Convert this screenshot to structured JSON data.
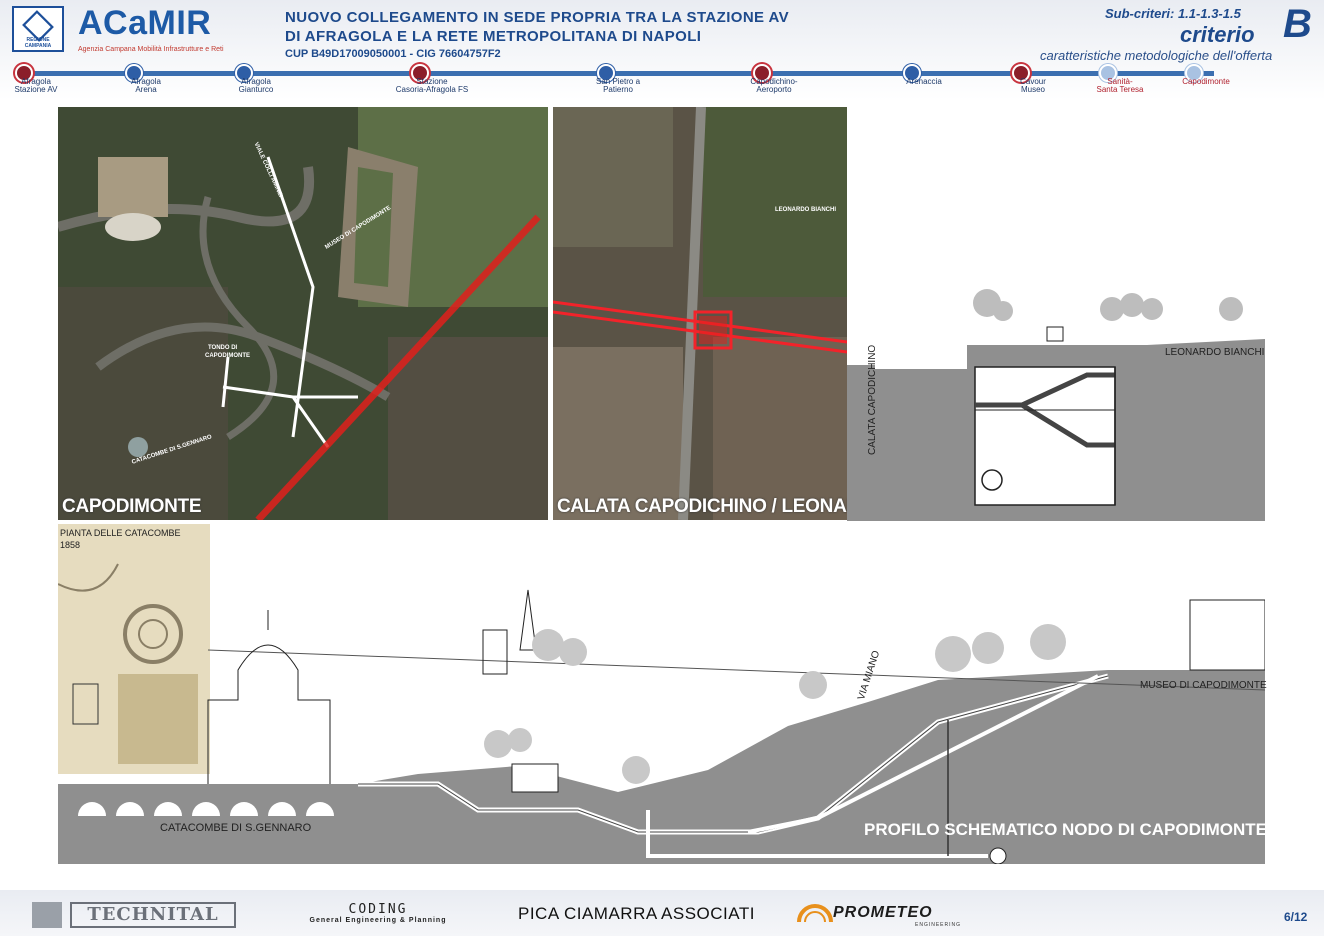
{
  "header": {
    "logo_name": "ACaMIR",
    "logo_sub": "Agenzia Campana Mobilità Infrastrutture e Reti",
    "logo_emblem_label": "REGIONE CAMPANIA",
    "title_line1": "NUOVO COLLEGAMENTO IN SEDE PROPRIA TRA LA STAZIONE AV",
    "title_line2": "DI AFRAGOLA E LA RETE METROPOLITANA DI NAPOLI",
    "cup": "CUP B49D17009050001 - CIG 76604757F2",
    "subcriteria": "Sub-criteri: 1.1-1.3-1.5",
    "criterio": "criterio",
    "criterio_letter": "B",
    "criterio_desc": "caratteristiche metodologiche dell'offerta"
  },
  "stations": [
    {
      "line1": "Afragola",
      "line2": "Stazione AV",
      "style": "red"
    },
    {
      "line1": "Afragola",
      "line2": "Arena",
      "style": "blue"
    },
    {
      "line1": "Afragola",
      "line2": "Gianturco",
      "style": "blue"
    },
    {
      "line1": "Stazione",
      "line2": "Casoria-Afragola FS",
      "style": "red"
    },
    {
      "line1": "San Pietro a",
      "line2": "Patierno",
      "style": "blue"
    },
    {
      "line1": "Capodichino-",
      "line2": "Aeroporto",
      "style": "red"
    },
    {
      "line1": "Arenaccia",
      "line2": "",
      "style": "blue"
    },
    {
      "line1": "Cavour",
      "line2": "Museo",
      "style": "red"
    },
    {
      "line1": "Sanità-",
      "line2": "Santa Teresa",
      "style": "pale"
    },
    {
      "line1": "Capodimonte",
      "line2": "",
      "style": "pale"
    }
  ],
  "images": {
    "capodimonte": {
      "caption": "CAPODIMONTE",
      "labels": {
        "viale": "VIALE COLLI AMINEI",
        "museo": "MUSEO DI CAPODIMONTE",
        "tondo1": "TONDO DI",
        "tondo2": "CAPODIMONTE",
        "catacombe": "CATACOMBE DI S.GENNARO"
      }
    },
    "calata": {
      "caption": "CALATA CAPODICHINO / LEONARDO BIANCHI",
      "labels": {
        "bianchi": "LEONARDO BIANCHI"
      }
    },
    "section": {
      "bianchi": "LEONARDO BIANCHI",
      "calata": "CALATA CAPODICHINO"
    },
    "plan": {
      "title": "PIANTA  DELLE CATACOMBE",
      "year": "1858"
    },
    "profile": {
      "catacombe": "CATACOMBE DI S.GENNARO",
      "via_miano": "VIA MIANO",
      "museo": "MUSEO DI CAPODIMONTE",
      "title": "PROFILO SCHEMATICO NODO DI CAPODIMONTE"
    }
  },
  "footer": {
    "technital": "TECHNITAL",
    "coding": "CODING",
    "coding_sub": "General Engineering & Planning",
    "pica": "PICA CIAMARRA ASSOCIATI",
    "prometeo": "PROMETEO",
    "prometeo_sub": "ENGINEERING",
    "page": "6/12"
  },
  "colors": {
    "brand_blue": "#1e4a8c",
    "line_blue": "#3b6fb0",
    "accent_red": "#c8343f",
    "route_red": "#e0201c"
  }
}
